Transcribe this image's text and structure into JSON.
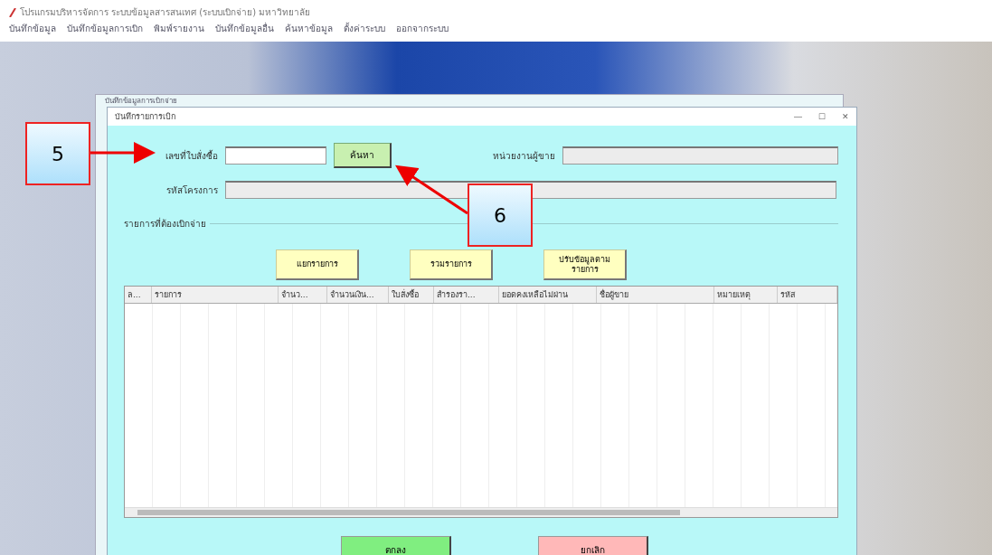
{
  "app": {
    "title": "โปรแกรมบริหารจัดการ ระบบข้อมูลสารสนเทศ (ระบบเบิกจ่าย) มหาวิทยาลัย",
    "menu": [
      "บันทึกข้อมูล",
      "บันทึกข้อมูลการเบิก",
      "พิมพ์รายงาน",
      "บันทึกข้อมูลอื่น",
      "ค้นหาข้อมูล",
      "ตั้งค่าระบบ",
      "ออกจากระบบ"
    ]
  },
  "back_window": {
    "title": "บันทึกข้อมูลการเบิกจ่าย"
  },
  "dialog": {
    "title": "บันทึกรายการเบิก",
    "controls": [
      "—",
      "☐",
      "✕"
    ],
    "fields": [
      {
        "label": "เลขที่ใบสั่งซื้อ",
        "disabled": false
      },
      {
        "label": "หน่วยงานผู้ขาย",
        "disabled": true
      },
      {
        "label": "รหัสโครงการ",
        "disabled": true
      }
    ],
    "search_button": "ค้นหา",
    "group_title": "รายการที่ต้องเบิกจ่าย",
    "actions": [
      "แยกรายการ",
      "รวมรายการ",
      "ปรับข้อมูลตาม\nรายการ"
    ],
    "table": {
      "columns": [
        "ล...",
        "รายการ",
        "จำนว...",
        "จำนวนเงิน...",
        "ใบสั่งซื้อ",
        "สำรองรา...",
        "ยอดคงเหลือไม่ผ่าน",
        "ชื่อผู้ขาย",
        "หมายเหตุ",
        "รหัส"
      ]
    },
    "buttons": [
      {
        "label": "ตกลง",
        "kind": "ok"
      },
      {
        "label": "ยกเลิก",
        "kind": "cancel"
      }
    ]
  },
  "callouts": [
    {
      "label": "5",
      "kind": "left"
    },
    {
      "label": "6",
      "kind": "below"
    }
  ]
}
